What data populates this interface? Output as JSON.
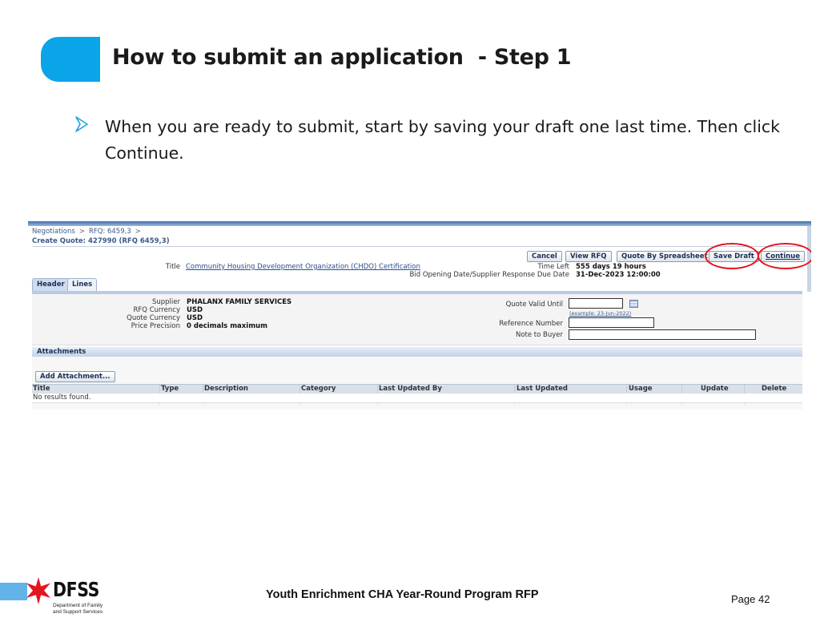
{
  "slide": {
    "title": "How to submit an application  - Step 1",
    "bullet": "When you are ready to submit, start by saving your draft one last time. Then click Continue.",
    "footer_title": "Youth Enrichment CHA Year-Round Program RFP",
    "page_label": "Page 42",
    "accent_color": "#0aa4e8",
    "logo": {
      "word": "DFSS",
      "subtitle": "Department of Family and Support Services"
    }
  },
  "screenshot": {
    "breadcrumbs": [
      "Negotiations",
      "RFQ: 6459,3"
    ],
    "page_heading": "Create Quote: 427990 (RFQ 6459,3)",
    "buttons": {
      "cancel": "Cancel",
      "view_rfq": "View RFQ",
      "quote_by_spreadsheet": "Quote By Spreadsheet",
      "save_draft": "Save Draft",
      "continue": "Continue"
    },
    "highlighted_buttons": [
      "Save Draft",
      "Continue"
    ],
    "highlight_color": "#e3161e",
    "title_label": "Title",
    "title_value": "Community Housing Development Organization (CHDO) Certification",
    "time_left_label": "Time Left",
    "time_left_value": "555 days 19 hours",
    "due_date_label": "Bid Opening Date/Supplier Response Due Date",
    "due_date_value": "31-Dec-2023 12:00:00",
    "tabs": [
      "Header",
      "Lines"
    ],
    "active_tab": "Header",
    "header_fields": {
      "supplier_label": "Supplier",
      "supplier_value": "PHALANX FAMILY SERVICES",
      "rfq_currency_label": "RFQ Currency",
      "rfq_currency_value": "USD",
      "quote_currency_label": "Quote Currency",
      "quote_currency_value": "USD",
      "price_precision_label": "Price Precision",
      "price_precision_value": "0 decimals maximum",
      "quote_valid_until_label": "Quote Valid Until",
      "quote_valid_until_value": "",
      "date_example": "(example: 23-Jun-2022)",
      "reference_number_label": "Reference Number",
      "reference_number_value": "",
      "note_to_buyer_label": "Note to Buyer",
      "note_to_buyer_value": ""
    },
    "attachments": {
      "section_title": "Attachments",
      "add_button": "Add Attachment...",
      "columns": [
        "Title",
        "Type",
        "Description",
        "Category",
        "Last Updated By",
        "Last Updated",
        "Usage",
        "Update",
        "Delete"
      ],
      "empty_message": "No results found."
    }
  }
}
